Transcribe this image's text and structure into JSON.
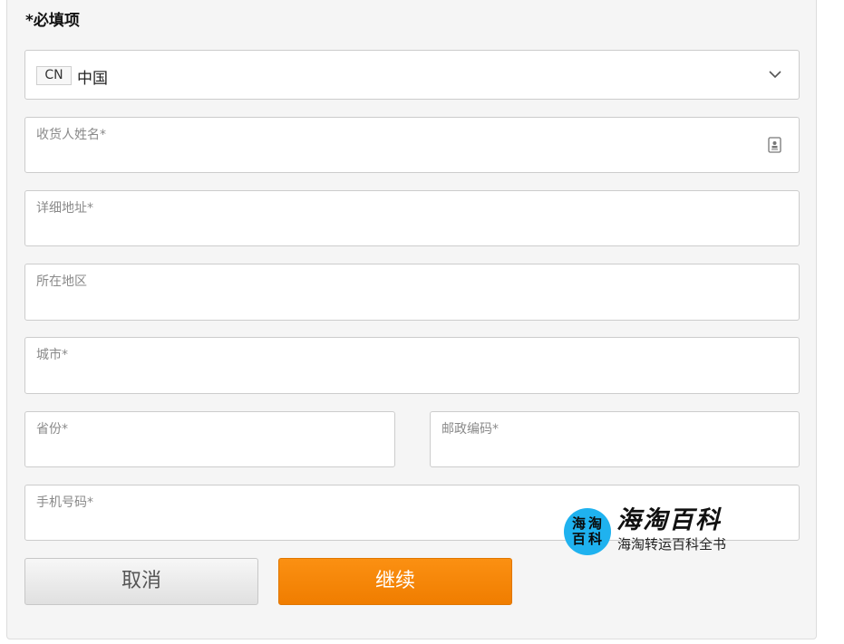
{
  "form": {
    "required_note": "*必填项",
    "country": {
      "code": "CN",
      "name": "中国"
    },
    "fields": {
      "recipient_name": {
        "label": "收货人姓名*",
        "value": ""
      },
      "address": {
        "label": "详细地址*",
        "value": ""
      },
      "region": {
        "label": "所在地区",
        "value": ""
      },
      "city": {
        "label": "城市*",
        "value": ""
      },
      "province": {
        "label": "省份*",
        "value": ""
      },
      "postal_code": {
        "label": "邮政编码*",
        "value": ""
      },
      "phone": {
        "label": "手机号码*",
        "value": ""
      }
    },
    "buttons": {
      "cancel": "取消",
      "continue": "继续"
    }
  },
  "watermark": {
    "logo_chars": [
      "海",
      "淘",
      "百",
      "科"
    ],
    "title": "海淘百科",
    "subtitle": "海淘转运百科全书"
  },
  "icons": {
    "dropdown": "chevron-down-icon",
    "contact_picker": "contact-card-icon"
  },
  "colors": {
    "accent": "#f28500",
    "watermark_blue": "#1fb2ef",
    "panel_bg": "#f5f5f5"
  }
}
